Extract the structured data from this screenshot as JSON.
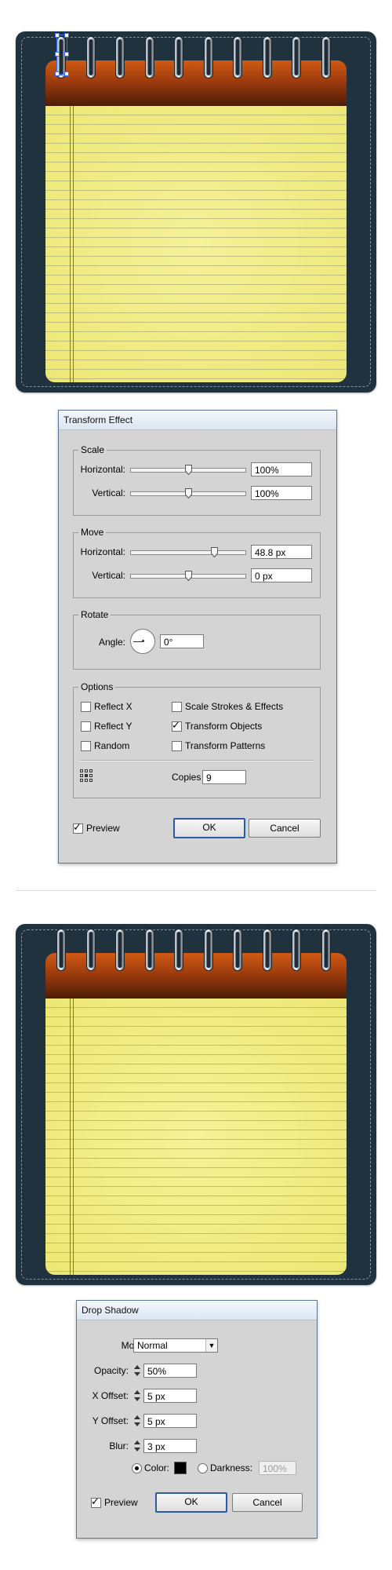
{
  "colors": {
    "board": "#21323f",
    "paper": "#ede873",
    "cover": "#9a3a0d",
    "selection": "#3b6df0",
    "dialog_bg": "#d4d4d4",
    "default_button_border": "#2a5aa8",
    "shadow_color": "#000000"
  },
  "icons": {
    "ring": "spiral-ring-icon",
    "origin": "reference-point-grid-icon",
    "spin": "spinner-arrows-icon",
    "dial": "angle-dial-icon"
  },
  "transform_effect": {
    "title": "Transform Effect",
    "scale": {
      "title": "Scale",
      "horizontal_label": "Horizontal:",
      "horizontal_value": "100%",
      "horizontal_slider": 0.5,
      "vertical_label": "Vertical:",
      "vertical_value": "100%",
      "vertical_slider": 0.5
    },
    "move": {
      "title": "Move",
      "horizontal_label": "Horizontal:",
      "horizontal_value": "48.8 px",
      "horizontal_slider": 0.72,
      "vertical_label": "Vertical:",
      "vertical_value": "0 px",
      "vertical_slider": 0.5
    },
    "rotate": {
      "title": "Rotate",
      "angle_label": "Angle:",
      "angle_value": "0°"
    },
    "options": {
      "title": "Options",
      "reflect_x": {
        "label": "Reflect X",
        "checked": false
      },
      "reflect_y": {
        "label": "Reflect Y",
        "checked": false
      },
      "random": {
        "label": "Random",
        "checked": false
      },
      "scale_strokes": {
        "label": "Scale Strokes & Effects",
        "checked": false
      },
      "transform_objects": {
        "label": "Transform Objects",
        "checked": true
      },
      "transform_patterns": {
        "label": "Transform Patterns",
        "checked": false
      },
      "copies_label": "Copies",
      "copies_value": "9"
    },
    "preview": {
      "label": "Preview",
      "checked": true
    },
    "ok_label": "OK",
    "cancel_label": "Cancel"
  },
  "drop_shadow": {
    "title": "Drop Shadow",
    "mode_label": "Mode:",
    "mode_value": "Normal",
    "opacity_label": "Opacity:",
    "opacity_value": "50%",
    "x_offset_label": "X Offset:",
    "x_offset_value": "5 px",
    "y_offset_label": "Y Offset:",
    "y_offset_value": "5 px",
    "blur_label": "Blur:",
    "blur_value": "3 px",
    "color_label": "Color:",
    "color_selected": true,
    "darkness_label": "Darkness:",
    "darkness_value": "100%",
    "preview": {
      "label": "Preview",
      "checked": true
    },
    "ok_label": "OK",
    "cancel_label": "Cancel"
  }
}
